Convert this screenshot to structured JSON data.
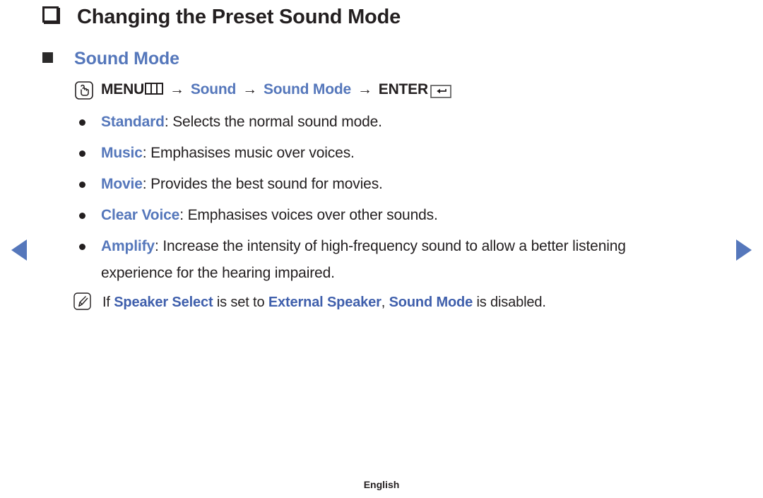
{
  "page": {
    "heading": "Changing the Preset Sound Mode",
    "subheading": "Sound Mode",
    "footer_label": "English",
    "accent_blue": "#5577bb",
    "note_blue": "#3f5fac",
    "text_dark": "#231f20",
    "background": "#ffffff"
  },
  "nav": {
    "prev_icon": "triangle-left-icon",
    "next_icon": "triangle-right-icon"
  },
  "menu_path": {
    "lead_icon": "press-hand-icon",
    "menu_label": "MENU",
    "menu_icon": "menu-bars-icon",
    "separator": "→",
    "step_1": "Sound",
    "step_2": "Sound Mode",
    "enter_label": "ENTER",
    "enter_icon": "enter-return-icon"
  },
  "options": [
    {
      "term": "Standard",
      "separator": ": ",
      "description": "Selects the normal sound mode."
    },
    {
      "term": "Music",
      "separator": ": ",
      "description": "Emphasises music over voices."
    },
    {
      "term": "Movie",
      "separator": ": ",
      "description": "Provides the best sound for movies."
    },
    {
      "term": "Clear Voice",
      "separator": ": ",
      "description": "Emphasises voices over other sounds."
    },
    {
      "term": "Amplify",
      "separator": ": ",
      "description": "Increase the intensity of high-frequency sound to allow a better listening experience for the hearing impaired."
    }
  ],
  "note": {
    "icon": "note-pencil-icon",
    "part_1": "If ",
    "term_1": "Speaker Select",
    "part_2": " is set to ",
    "term_2": "External Speaker",
    "part_3": ", ",
    "term_3": "Sound Mode",
    "part_4": " is disabled."
  }
}
